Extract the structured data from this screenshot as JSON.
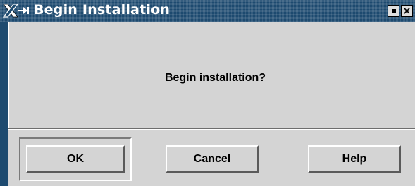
{
  "window": {
    "title": "Begin Installation",
    "titlebar_color": "#1d4a6f",
    "background_color": "#d4d4d4"
  },
  "titlebar": {
    "logo_icon": "x-logo-icon",
    "menu_icon": "arrow-to-bar-icon",
    "minimize_icon": "minimize-icon",
    "close_icon": "close-icon",
    "close_glyph": "×"
  },
  "dialog": {
    "message": "Begin installation?"
  },
  "buttons": {
    "ok_label": "OK",
    "cancel_label": "Cancel",
    "help_label": "Help",
    "default": "OK"
  }
}
